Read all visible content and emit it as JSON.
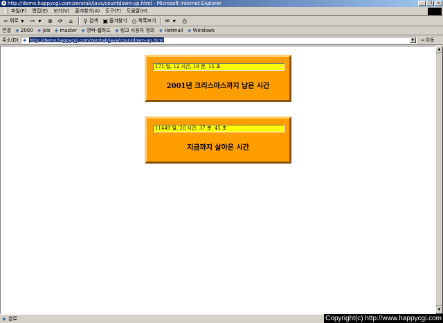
{
  "window": {
    "title": "http://demo.happycgi.com/zerotak/java/countdown-up.html - Microsoft Internet Explorer",
    "minimize": "_",
    "maximize": "❐",
    "close": "×"
  },
  "menu": [
    "파일(F)",
    "편집(E)",
    "보기(V)",
    "즐겨찾기(A)",
    "도구(T)",
    "도움말(H)"
  ],
  "toolbar": {
    "back": "뒤로",
    "search": "검색",
    "favorites": "즐겨찾기",
    "history": "목록보기"
  },
  "links": {
    "label": "연결",
    "items": [
      "2000",
      "job",
      "master",
      "영락-웹하드",
      "링크 사용자 정의",
      "Hotmail",
      "Windows"
    ]
  },
  "address": {
    "label": "주소(D)",
    "url": "http://demo.happycgi.com/zerotak/java/countdown-up.html",
    "go": "이동"
  },
  "countdowns": [
    {
      "counter": "171 일, 12 시간, 19 분, 15 초",
      "label": "2001년 크리스마스까지 남은 시간"
    },
    {
      "counter": "11449 일, 20 시간, 37 분, 45 초",
      "label": "지금까지 살아온 시간"
    }
  ],
  "status": {
    "text": "완료"
  },
  "copyright": "Copyright(c) http://www.happycgi.com",
  "colors": {
    "panel": "#ff9e00",
    "counter_bg": "#ffff00",
    "titlebar": "#0a246a"
  }
}
